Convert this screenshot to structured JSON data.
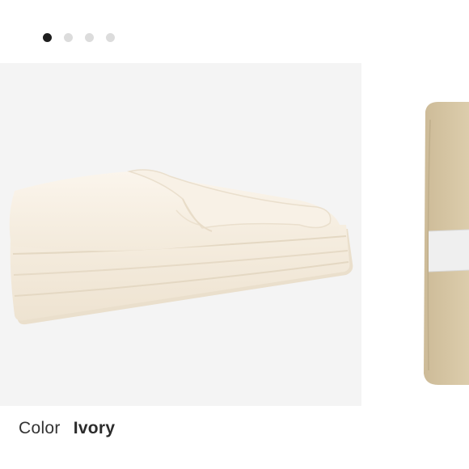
{
  "carousel": {
    "slide_count": 4,
    "active_index": 0,
    "slides": [
      {
        "icon": "ivory-folded-blanket"
      },
      {
        "icon": "tan-rolled-blanket-with-band"
      }
    ]
  },
  "product": {
    "color_label": "Color",
    "color_value": "Ivory"
  },
  "colors": {
    "active_dot": "#1e1e1e",
    "inactive_dot": "#dcdcdc",
    "blanket_ivory": "#f7efe2",
    "blanket_tan": "#d8c8a6",
    "band": "#ececec",
    "text": "#333333"
  }
}
